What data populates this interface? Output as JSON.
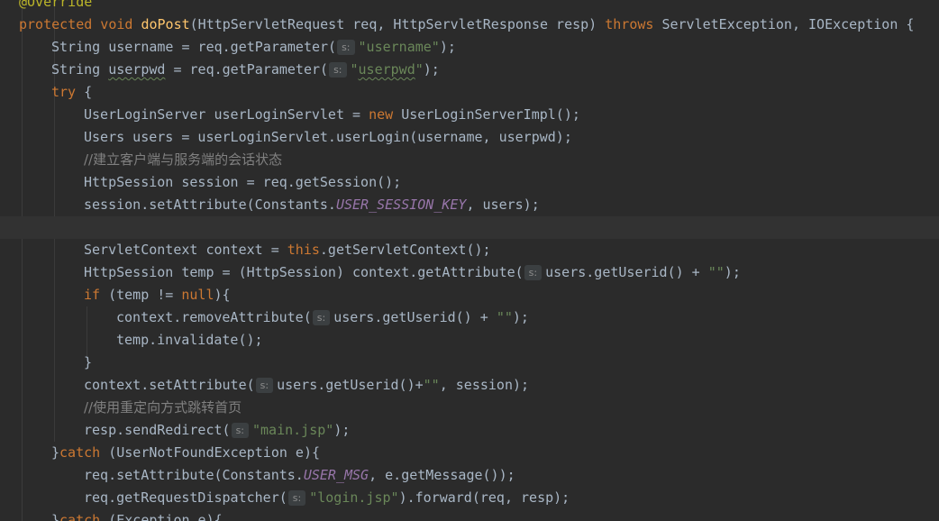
{
  "editor": {
    "language": "java",
    "colors": {
      "background": "#2b2b2b",
      "current_line": "#323232",
      "keyword": "#cc7832",
      "string": "#6a8759",
      "method_declaration": "#ffc66d",
      "comment": "#808080",
      "annotation": "#bbb529",
      "constant": "#9876aa",
      "plain": "#a9b7c6",
      "param_hint_bg": "#3b3f41"
    },
    "lines": [
      {
        "indent": 0,
        "tokens": [
          {
            "t": "@Override",
            "c": "a"
          }
        ]
      },
      {
        "indent": 0,
        "tokens": [
          {
            "t": "protected void ",
            "c": "k"
          },
          {
            "t": "doPost",
            "c": "f"
          },
          {
            "t": "(HttpServletRequest req, HttpServletResponse resp) ",
            "c": "p"
          },
          {
            "t": "throws ",
            "c": "k"
          },
          {
            "t": "ServletException, IOException {",
            "c": "p"
          }
        ]
      },
      {
        "indent": 1,
        "tokens": [
          {
            "t": "String username = req.getParameter(",
            "c": "p"
          },
          {
            "t": "s:",
            "c": "hint"
          },
          {
            "t": "\"username\"",
            "c": "s"
          },
          {
            "t": ");",
            "c": "p"
          }
        ]
      },
      {
        "indent": 1,
        "tokens": [
          {
            "t": "String ",
            "c": "p"
          },
          {
            "t": "userpwd",
            "c": "p u"
          },
          {
            "t": " = req.getParameter(",
            "c": "p"
          },
          {
            "t": "s:",
            "c": "hint"
          },
          {
            "t": "\"",
            "c": "s"
          },
          {
            "t": "userpwd",
            "c": "s u"
          },
          {
            "t": "\"",
            "c": "s"
          },
          {
            "t": ");",
            "c": "p"
          }
        ]
      },
      {
        "indent": 1,
        "tokens": [
          {
            "t": "try ",
            "c": "k"
          },
          {
            "t": "{",
            "c": "p"
          }
        ]
      },
      {
        "indent": 2,
        "tokens": [
          {
            "t": "UserLoginServer userLoginServlet = ",
            "c": "p"
          },
          {
            "t": "new ",
            "c": "k"
          },
          {
            "t": "UserLoginServerImpl();",
            "c": "p"
          }
        ]
      },
      {
        "indent": 2,
        "tokens": [
          {
            "t": "Users users = userLoginServlet.userLogin(username, userpwd);",
            "c": "p"
          }
        ]
      },
      {
        "indent": 2,
        "tokens": [
          {
            "t": "//建立客户端与服务端的会话状态",
            "c": "c"
          }
        ]
      },
      {
        "indent": 2,
        "tokens": [
          {
            "t": "HttpSession session = req.getSession();",
            "c": "p"
          }
        ]
      },
      {
        "indent": 2,
        "tokens": [
          {
            "t": "session.setAttribute(Constants.",
            "c": "p"
          },
          {
            "t": "USER_SESSION_KEY",
            "c": "con"
          },
          {
            "t": ", users);",
            "c": "p"
          }
        ]
      },
      {
        "indent": 2,
        "current": true,
        "tokens": []
      },
      {
        "indent": 2,
        "tokens": [
          {
            "t": "ServletContext context = ",
            "c": "p"
          },
          {
            "t": "this",
            "c": "k"
          },
          {
            "t": ".getServletContext();",
            "c": "p"
          }
        ]
      },
      {
        "indent": 2,
        "tokens": [
          {
            "t": "HttpSession temp = (HttpSession) context.getAttribute(",
            "c": "p"
          },
          {
            "t": "s:",
            "c": "hint"
          },
          {
            "t": "users.getUserid() + ",
            "c": "p"
          },
          {
            "t": "\"\"",
            "c": "s"
          },
          {
            "t": ");",
            "c": "p"
          }
        ]
      },
      {
        "indent": 2,
        "tokens": [
          {
            "t": "if ",
            "c": "k"
          },
          {
            "t": "(temp != ",
            "c": "p"
          },
          {
            "t": "null",
            "c": "k"
          },
          {
            "t": "){",
            "c": "p"
          }
        ]
      },
      {
        "indent": 3,
        "tokens": [
          {
            "t": "context.removeAttribute(",
            "c": "p"
          },
          {
            "t": "s:",
            "c": "hint"
          },
          {
            "t": "users.getUserid() + ",
            "c": "p"
          },
          {
            "t": "\"\"",
            "c": "s"
          },
          {
            "t": ");",
            "c": "p"
          }
        ]
      },
      {
        "indent": 3,
        "tokens": [
          {
            "t": "temp.invalidate();",
            "c": "p"
          }
        ]
      },
      {
        "indent": 2,
        "tokens": [
          {
            "t": "}",
            "c": "p"
          }
        ]
      },
      {
        "indent": 2,
        "tokens": [
          {
            "t": "context.setAttribute(",
            "c": "p"
          },
          {
            "t": "s:",
            "c": "hint"
          },
          {
            "t": "users.getUserid()+",
            "c": "p"
          },
          {
            "t": "\"\"",
            "c": "s"
          },
          {
            "t": ", session);",
            "c": "p"
          }
        ]
      },
      {
        "indent": 2,
        "tokens": [
          {
            "t": "//使用重定向方式跳转首页",
            "c": "c"
          }
        ]
      },
      {
        "indent": 2,
        "tokens": [
          {
            "t": "resp.sendRedirect(",
            "c": "p"
          },
          {
            "t": "s:",
            "c": "hint"
          },
          {
            "t": "\"main.jsp\"",
            "c": "s"
          },
          {
            "t": ");",
            "c": "p"
          }
        ]
      },
      {
        "indent": 1,
        "tokens": [
          {
            "t": "}",
            "c": "p"
          },
          {
            "t": "catch ",
            "c": "k"
          },
          {
            "t": "(UserNotFoundException e){",
            "c": "p"
          }
        ]
      },
      {
        "indent": 2,
        "tokens": [
          {
            "t": "req.setAttribute(Constants.",
            "c": "p"
          },
          {
            "t": "USER_MSG",
            "c": "con"
          },
          {
            "t": ", e.getMessage());",
            "c": "p"
          }
        ]
      },
      {
        "indent": 2,
        "tokens": [
          {
            "t": "req.getRequestDispatcher(",
            "c": "p"
          },
          {
            "t": "s:",
            "c": "hint"
          },
          {
            "t": "\"login.jsp\"",
            "c": "s"
          },
          {
            "t": ").forward(req, resp);",
            "c": "p"
          }
        ]
      },
      {
        "indent": 1,
        "tokens": [
          {
            "t": "}",
            "c": "p"
          },
          {
            "t": "catch ",
            "c": "k"
          },
          {
            "t": "(Exception e){",
            "c": "p"
          }
        ]
      }
    ]
  }
}
